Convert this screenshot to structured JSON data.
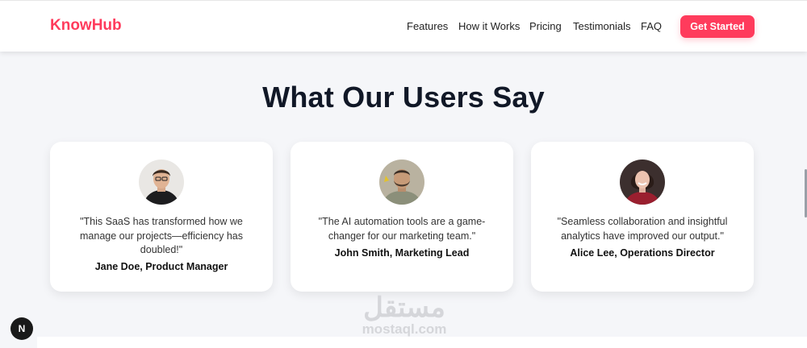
{
  "colors": {
    "brand": "#ff3b5c",
    "page_bg": "#f5f6f9",
    "card_bg": "#ffffff",
    "heading": "#111827"
  },
  "header": {
    "logo": "KnowHub",
    "nav": [
      "Features",
      "How it Works",
      "Pricing",
      "Testimonials",
      "FAQ"
    ],
    "cta": "Get Started"
  },
  "section": {
    "title": "What Our Users Say"
  },
  "testimonials": [
    {
      "quote_lines": [
        "\"This SaaS has transformed how we",
        "manage our projects—efficiency has",
        "doubled!\""
      ],
      "author": "Jane Doe, Product Manager",
      "avatar_icon": "man-portrait-avatar"
    },
    {
      "quote_lines": [
        "\"The AI automation tools are a game-",
        "changer for our marketing team.\""
      ],
      "author": "John Smith, Marketing Lead",
      "avatar_icon": "man-portrait-avatar"
    },
    {
      "quote_lines": [
        "\"Seamless collaboration and insightful",
        "analytics have improved our output.\""
      ],
      "author": "Alice Lee, Operations Director",
      "avatar_icon": "woman-portrait-avatar"
    }
  ],
  "watermark": {
    "arabic": "مستقل",
    "latin": "mostaql.com"
  },
  "floating": {
    "label": "N"
  }
}
